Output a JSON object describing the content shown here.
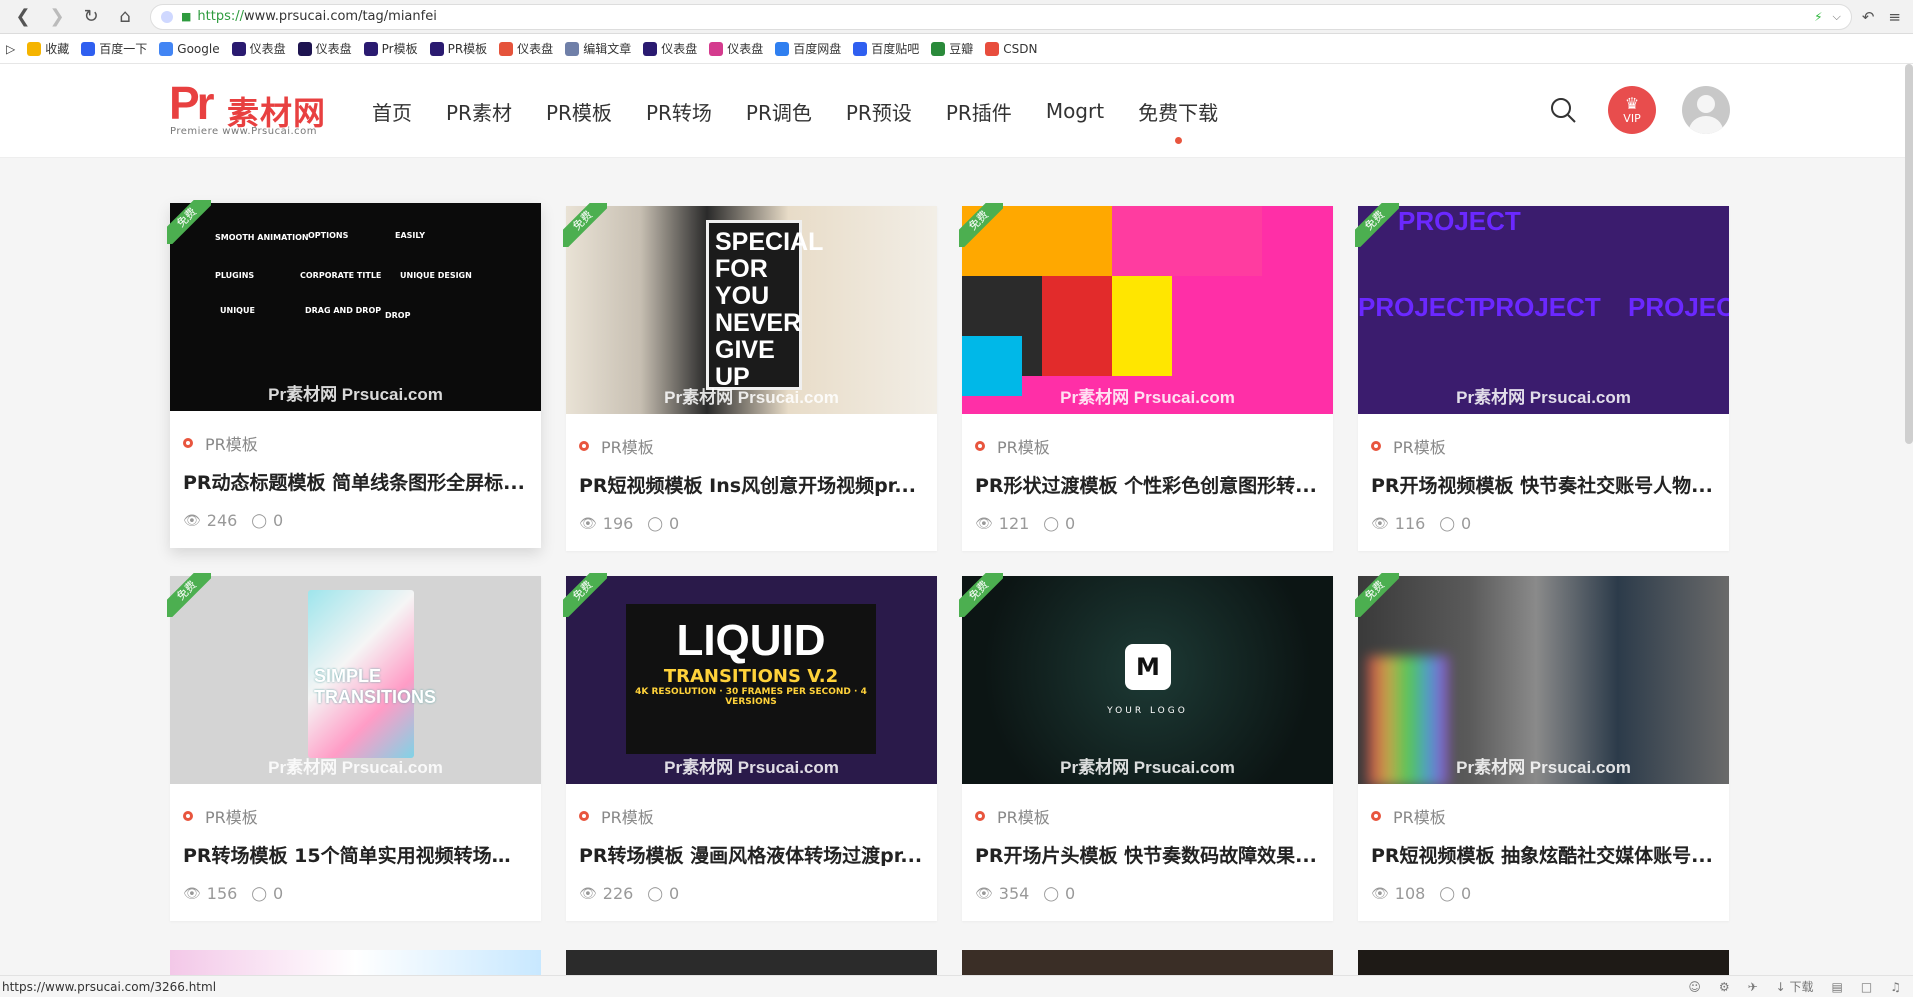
{
  "browser": {
    "url": "https://www.prsucai.com/tag/mianfei",
    "url_scheme": "https://",
    "url_rest": "www.prsucai.com/tag/mianfei",
    "status_url": "https://www.prsucai.com/3266.html",
    "status_download": "下载"
  },
  "bookmarks": [
    {
      "label": "收藏",
      "icon": "star-icon",
      "color": "#f5b400"
    },
    {
      "label": "百度一下",
      "icon": "baidu-icon",
      "color": "#2f5ff0"
    },
    {
      "label": "Google",
      "icon": "google-icon",
      "color": "#4285f4"
    },
    {
      "label": "仪表盘",
      "icon": "pr-icon",
      "color": "#2a1a70"
    },
    {
      "label": "仪表盘",
      "icon": "ae-icon",
      "color": "#1e1450"
    },
    {
      "label": "Pr模板",
      "icon": "pr-icon",
      "color": "#2a1a70"
    },
    {
      "label": "PR模板",
      "icon": "pr-icon",
      "color": "#2a1a70"
    },
    {
      "label": "仪表盘",
      "icon": "puzzle-icon",
      "color": "#e5533b"
    },
    {
      "label": "编辑文章",
      "icon": "doc-icon",
      "color": "#6f7fa8"
    },
    {
      "label": "仪表盘",
      "icon": "pr-icon",
      "color": "#2a1a70"
    },
    {
      "label": "仪表盘",
      "icon": "color-wheel-icon",
      "color": "#d43b8e"
    },
    {
      "label": "百度网盘",
      "icon": "cloud-icon",
      "color": "#2f7ff0"
    },
    {
      "label": "百度贴吧",
      "icon": "paw-icon",
      "color": "#2f5ff0"
    },
    {
      "label": "豆瓣",
      "icon": "douban-icon",
      "color": "#2a8a3a"
    },
    {
      "label": "CSDN",
      "icon": "csdn-icon",
      "color": "#e84d3d"
    }
  ],
  "site": {
    "logo_pr": "Pr",
    "logo_cn": "素材网",
    "logo_sub": "Premiere  www.Prsucai.com",
    "nav": [
      "首页",
      "PR素材",
      "PR模板",
      "PR转场",
      "PR调色",
      "PR预设",
      "PR插件",
      "Mogrt",
      "免费下载"
    ],
    "vip_label": "VIP"
  },
  "ribbon_label": "免费",
  "watermark": "Pr素材网 Prsucai.com",
  "cards": [
    {
      "category": "PR模板",
      "title": "PR动态标题模板 简单线条图形全屏标...",
      "views": "246",
      "comments": "0"
    },
    {
      "category": "PR模板",
      "title": "PR短视频模板 Ins风创意开场视频pr...",
      "views": "196",
      "comments": "0"
    },
    {
      "category": "PR模板",
      "title": "PR形状过渡模板 个性彩色创意图形转...",
      "views": "121",
      "comments": "0"
    },
    {
      "category": "PR模板",
      "title": "PR开场视频模板 快节奏社交账号人物...",
      "views": "116",
      "comments": "0"
    },
    {
      "category": "PR模板",
      "title": "PR转场模板 15个简单实用视频转场过...",
      "views": "156",
      "comments": "0"
    },
    {
      "category": "PR模板",
      "title": "PR转场模板 漫画风格液体转场过渡pr...",
      "views": "226",
      "comments": "0"
    },
    {
      "category": "PR模板",
      "title": "PR开场片头模板 快节奏数码故障效果...",
      "views": "354",
      "comments": "0"
    },
    {
      "category": "PR模板",
      "title": "PR短视频模板 抽象炫酷社交媒体账号...",
      "views": "108",
      "comments": "0"
    }
  ],
  "thumb_text": {
    "t1": [
      "SMOOTH ANIMATION",
      "OPTIONS",
      "EASILY",
      "PLUGINS",
      "CORPORATE TITLE",
      "UNIQUE DESIGN",
      "UNIQUE",
      "DRAG AND DROP",
      "DROP"
    ],
    "t2": "SPECIAL FOR YOU NEVER GIVE UP",
    "t4": "PROJECT",
    "t5": "SIMPLE TRANSITIONS",
    "t6_big": "LIQUID",
    "t6_mid": "TRANSITIONS V.2",
    "t6_small": "4K RESOLUTION · 30 FRAMES PER SECOND · 4 VERSIONS",
    "t7_m": "M",
    "t7_logo": "YOUR LOGO"
  }
}
